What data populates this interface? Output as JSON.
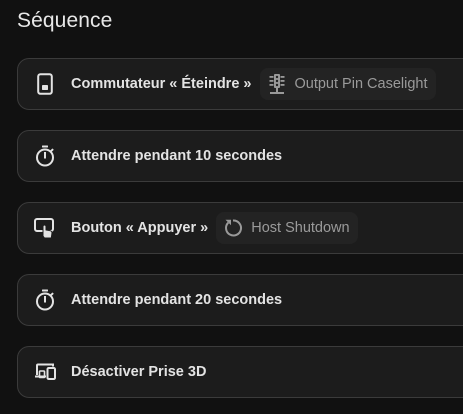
{
  "section": {
    "title": "Séquence"
  },
  "steps": [
    {
      "icon": "light-switch-icon",
      "label": "Commutateur « Éteindre »",
      "chip": {
        "icon": "traffic-light-icon",
        "label": "Output Pin Caselight"
      }
    },
    {
      "icon": "timer-icon",
      "label": "Attendre pendant 10 secondes"
    },
    {
      "icon": "gesture-tap-button-icon",
      "label": "Bouton « Appuyer »",
      "chip": {
        "icon": "restart-icon",
        "label": "Host Shutdown"
      }
    },
    {
      "icon": "timer-icon",
      "label": "Attendre pendant 20 secondes"
    },
    {
      "icon": "devices-icon",
      "label": "Désactiver Prise 3D"
    }
  ],
  "colors": {
    "background": "#111111",
    "card_background": "#1c1c1c",
    "card_border": "#3b3b3b",
    "chip_background": "#232323",
    "text_primary": "#e3e3e3",
    "text_secondary": "#9a9a9a"
  }
}
